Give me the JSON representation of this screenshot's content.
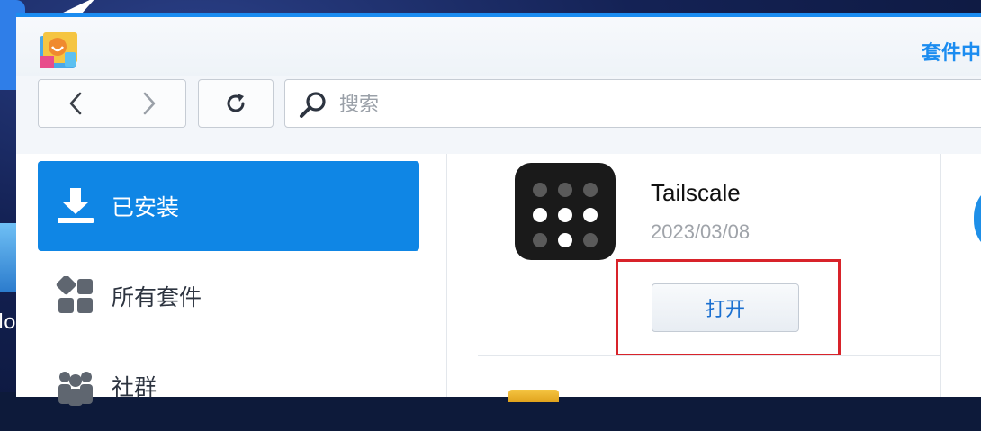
{
  "desktop": {
    "partial_label": "lo"
  },
  "window": {
    "title": "套件中"
  },
  "toolbar": {
    "search_placeholder": "搜索"
  },
  "sidebar": {
    "items": [
      {
        "label": "已安装",
        "icon": "download-icon",
        "active": true
      },
      {
        "label": "所有套件",
        "icon": "grid-icon",
        "active": false
      },
      {
        "label": "社群",
        "icon": "community-icon",
        "active": false
      }
    ]
  },
  "package": {
    "name": "Tailscale",
    "date": "2023/03/08",
    "open_label": "打开",
    "icon": "tailscale-icon"
  },
  "colors": {
    "accent": "#1b8cf0",
    "active_item": "#0f86e5",
    "highlight": "#d8232a"
  }
}
